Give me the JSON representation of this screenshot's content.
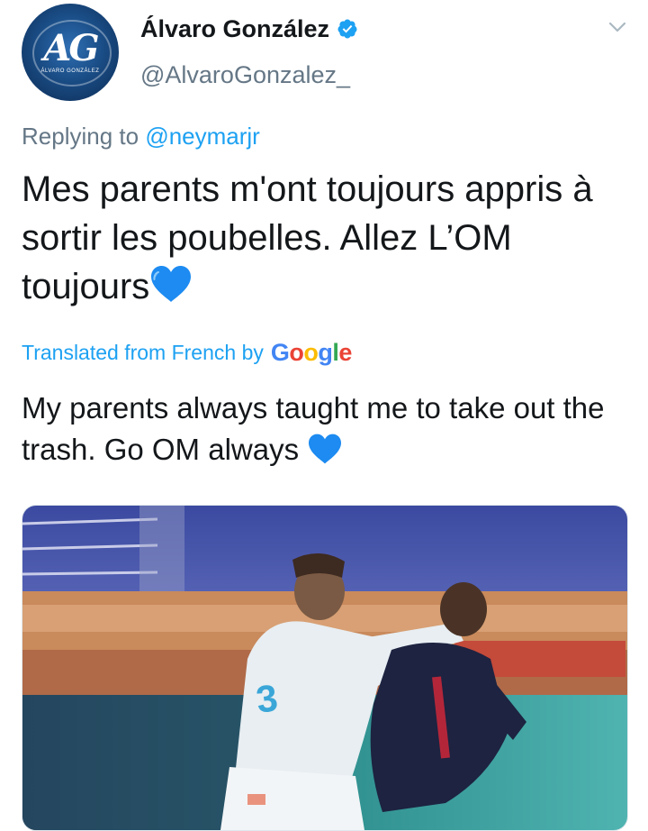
{
  "user": {
    "display_name": "Álvaro González",
    "handle": "@AlvaroGonzalez_",
    "avatar_initials": "AG",
    "avatar_caption": "ÁLVARO GONZÁLEZ",
    "verified": true,
    "verified_icon": "verified-badge-icon"
  },
  "reply": {
    "prefix": "Replying to",
    "target": "@neymarjr"
  },
  "tweet": {
    "text": "Mes parents m'ont toujours appris à sortir les poubelles. Allez L’OM toujours",
    "emoji": "blue-heart-icon"
  },
  "translation": {
    "label": "Translated from French by",
    "provider": "Google",
    "text": "My parents always taught me to take out the trash. Go OM always"
  },
  "menu_icon": "chevron-down-icon",
  "colors": {
    "link": "#1da1f2",
    "secondary_text": "#657786",
    "primary_text": "#14171a",
    "heart": "#1d8bf1"
  }
}
